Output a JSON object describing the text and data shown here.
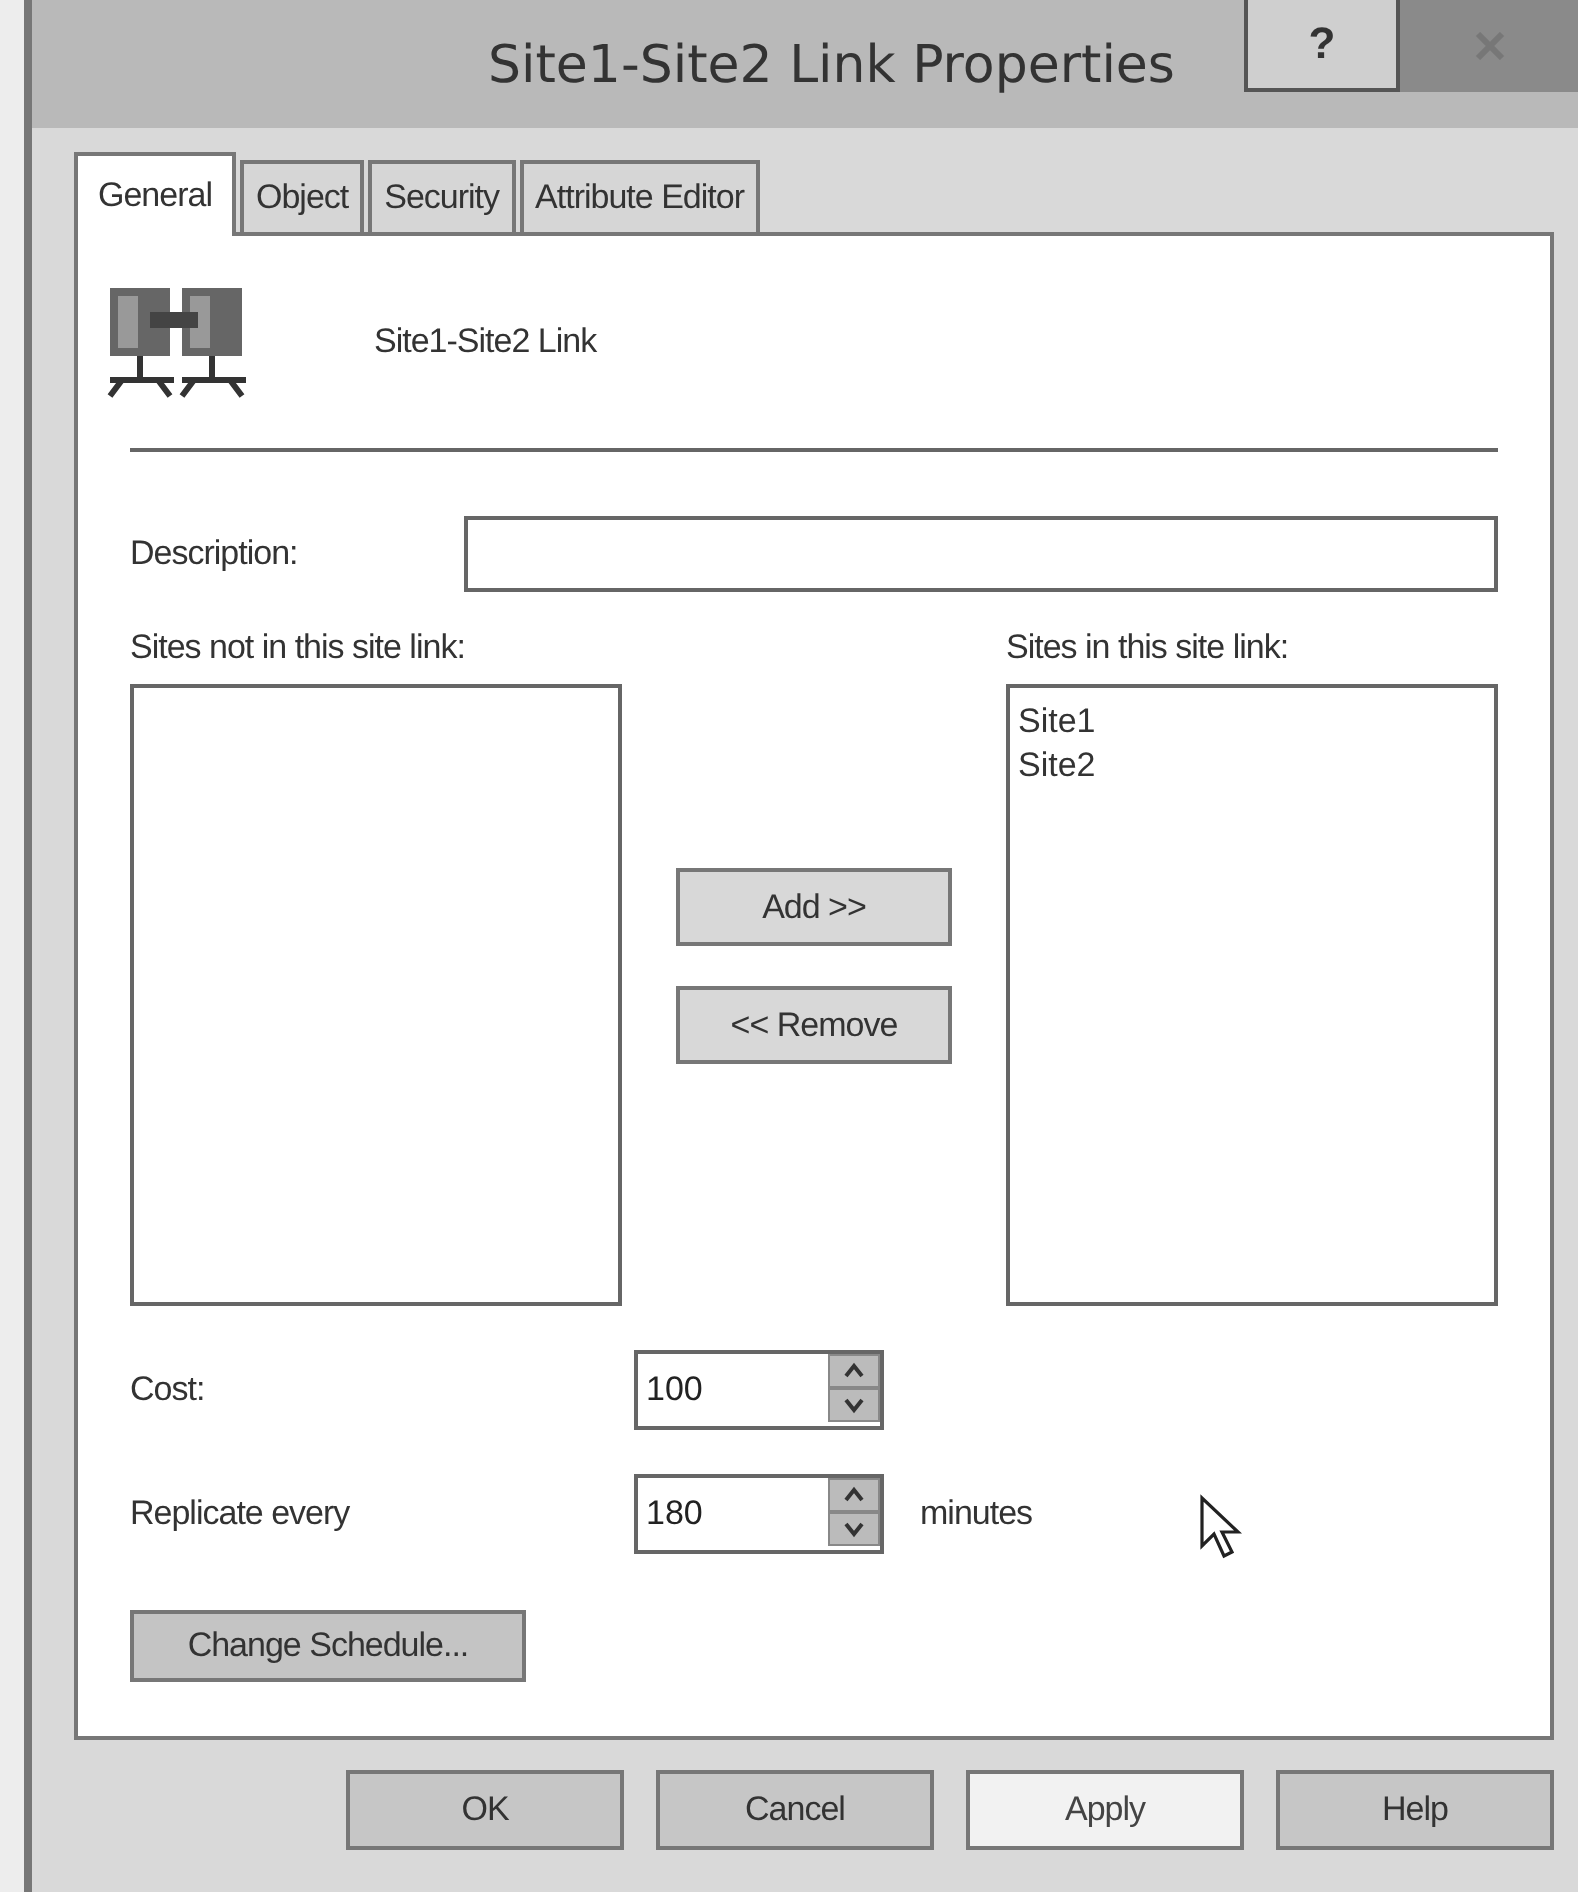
{
  "window": {
    "title": "Site1-Site2 Link Properties",
    "help_button": "?"
  },
  "tabs": [
    {
      "label": "General",
      "selected": true
    },
    {
      "label": "Object",
      "selected": false
    },
    {
      "label": "Security",
      "selected": false
    },
    {
      "label": "Attribute Editor",
      "selected": false
    }
  ],
  "object_name": "Site1-Site2 Link",
  "description": {
    "label": "Description:"
  },
  "sites_not_in_link": {
    "label": "Sites not in this site link:"
  },
  "sites_in_link": {
    "label": "Sites in this site link:",
    "items": [
      {
        "label": "Site1",
        "selected": false
      },
      {
        "label": "Site2",
        "selected": false
      }
    ]
  },
  "transfer_buttons": [
    "Add >>",
    "<< Remove"
  ],
  "cost": {
    "label": "Cost:",
    "value": "100"
  },
  "replicate": {
    "label": "Replicate every",
    "value": "180",
    "unit": "minutes"
  },
  "schedule_button": "Change Schedule...",
  "buttons": [
    {
      "label": "OK",
      "disabled": false
    },
    {
      "label": "Cancel",
      "disabled": false
    },
    {
      "label": "Apply",
      "disabled": true
    },
    {
      "label": "Help",
      "disabled": false
    }
  ]
}
